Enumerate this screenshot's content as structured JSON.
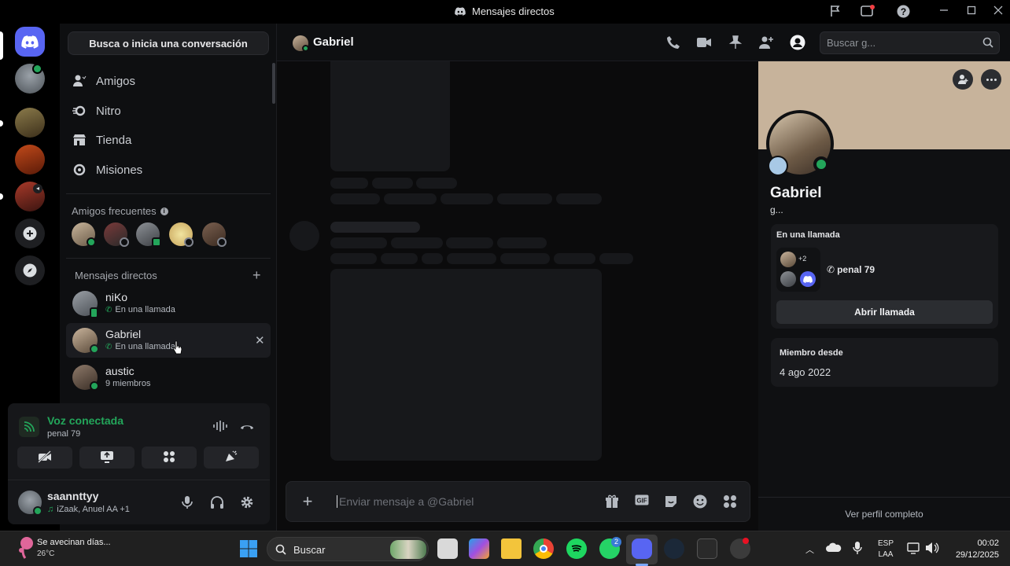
{
  "window": {
    "title": "Mensajes directos",
    "accent": "#5865f2",
    "online_color": "#23a55a"
  },
  "sidebar": {
    "search_label": "Busca o inicia una conversación",
    "nav": [
      {
        "label": "Amigos",
        "icon": "friends-icon"
      },
      {
        "label": "Nitro",
        "icon": "nitro-icon"
      },
      {
        "label": "Tienda",
        "icon": "shop-icon"
      },
      {
        "label": "Misiones",
        "icon": "quests-icon"
      }
    ],
    "frequent_label": "Amigos frecuentes",
    "dm_label": "Mensajes directos",
    "dms": [
      {
        "name": "niKo",
        "sub": "En una llamada"
      },
      {
        "name": "Gabriel",
        "sub": "En una llamada"
      },
      {
        "name": "austic",
        "sub": "9 miembros"
      }
    ]
  },
  "voice": {
    "status": "Voz conectada",
    "channel": "penal 79"
  },
  "user": {
    "name": "saannttyy",
    "activity": "iZaak, Anuel AA +1"
  },
  "header": {
    "name": "Gabriel",
    "search_placeholder": "Buscar g..."
  },
  "composer": {
    "placeholder": "Enviar mensaje a @Gabriel"
  },
  "profile": {
    "name": "Gabriel",
    "username": "g...",
    "call_title": "En una llamada",
    "call_extra": "+2",
    "call_channel": "penal 79",
    "open_call": "Abrir llamada",
    "member_since_label": "Miembro desde",
    "member_since": "4 ago 2022",
    "full_profile": "Ver perfil completo"
  },
  "taskbar": {
    "weather_title": "Se avecinan días...",
    "weather_temp": "26°C",
    "search": "Buscar",
    "lang1": "ESP",
    "lang2": "LAA",
    "time": "00:02",
    "date": "29/12/2025",
    "notif_badge": "2"
  }
}
